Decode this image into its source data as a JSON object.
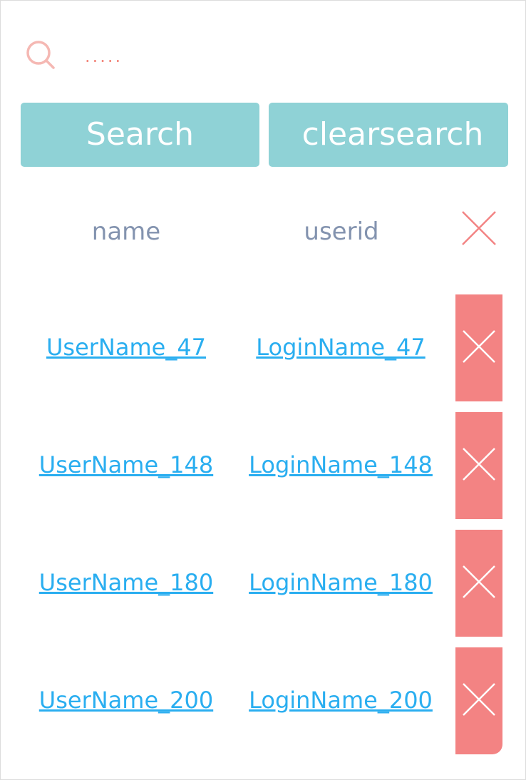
{
  "search": {
    "placeholder": ".....",
    "value": ""
  },
  "buttons": {
    "search_label": "Search",
    "clear_label": "clearsearch"
  },
  "table": {
    "headers": {
      "name": "name",
      "userid": "userid"
    },
    "rows": [
      {
        "name": "UserName_47",
        "userid": "LoginName_47"
      },
      {
        "name": "UserName_148",
        "userid": "LoginName_148"
      },
      {
        "name": "UserName_180",
        "userid": "LoginName_180"
      },
      {
        "name": "UserName_200",
        "userid": "LoginName_200"
      }
    ]
  },
  "icons": {
    "search": "search-icon",
    "header_close": "close-icon",
    "row_delete": "close-icon"
  },
  "colors": {
    "accent_teal": "#8fd2d6",
    "delete_red": "#f38383",
    "link_blue": "#2aaef0",
    "header_text": "#8393af",
    "search_icon": "#f5b8b3"
  }
}
